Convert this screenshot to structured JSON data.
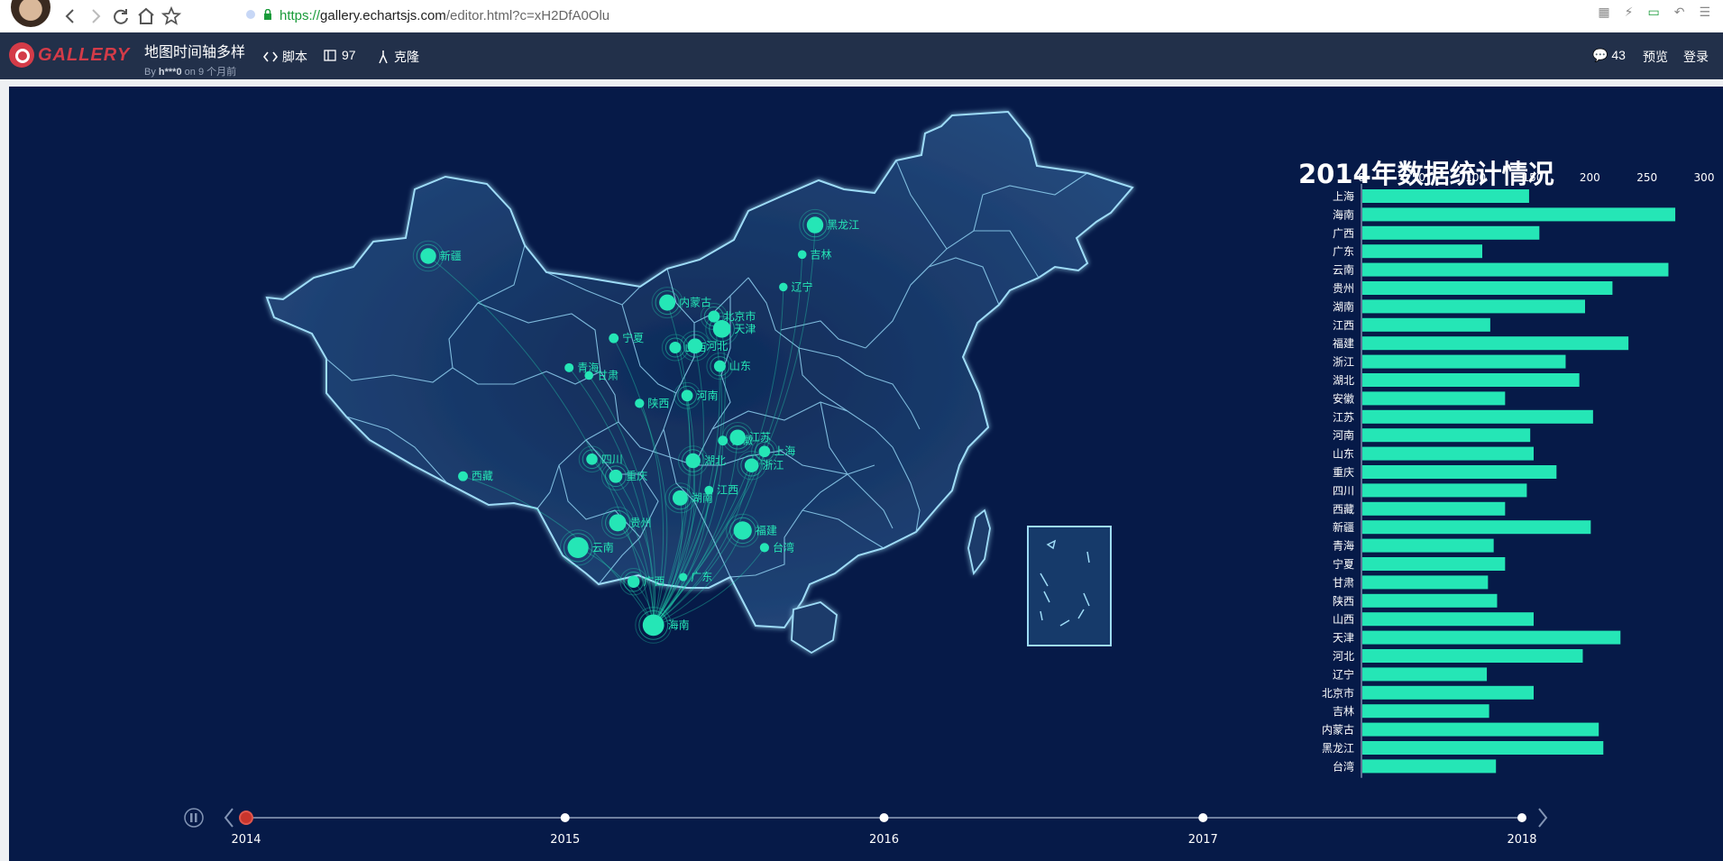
{
  "browser": {
    "url_scheme": "https://",
    "url_host": "gallery.echartsjs.com",
    "url_path": "/editor.html?c=xH2DfA0Olu",
    "back_icon": "chevron-left-icon",
    "forward_icon": "chevron-right-icon",
    "reload_icon": "reload-icon",
    "home_icon": "home-icon",
    "star_icon": "star-icon"
  },
  "appbar": {
    "logo_text": "GALLERY",
    "title": "地图时间轴多样",
    "byline_prefix": "By",
    "author": "h***0",
    "byline_time": "on 9 个月前",
    "script_label": "脚本",
    "likes_count": "97",
    "clone_label": "克隆",
    "comments_count": "43",
    "preview_label": "预览",
    "login_label": "登录"
  },
  "colors": {
    "background": "#061a48",
    "map_fill": "#1f3a6a",
    "map_border": "#8fd4f5",
    "accent": "#25e6b6",
    "timeline_active": "#c8352d"
  },
  "map": {
    "cities": [
      {
        "name": "新疆",
        "value": 200,
        "lon": 87.6,
        "lat": 43.8
      },
      {
        "name": "西藏",
        "value": 125,
        "lon": 91.1,
        "lat": 29.6
      },
      {
        "name": "青海",
        "value": 115,
        "lon": 101.8,
        "lat": 36.6
      },
      {
        "name": "甘肃",
        "value": 110,
        "lon": 103.8,
        "lat": 36.1
      },
      {
        "name": "宁夏",
        "value": 125,
        "lon": 106.3,
        "lat": 38.5
      },
      {
        "name": "内蒙古",
        "value": 207,
        "lon": 111.7,
        "lat": 40.8
      },
      {
        "name": "陕西",
        "value": 118,
        "lon": 108.9,
        "lat": 34.3
      },
      {
        "name": "山西",
        "value": 150,
        "lon": 112.5,
        "lat": 37.9
      },
      {
        "name": "河北",
        "value": 193,
        "lon": 114.5,
        "lat": 38.0
      },
      {
        "name": "北京市",
        "value": 150,
        "lon": 116.4,
        "lat": 39.9
      },
      {
        "name": "天津",
        "value": 226,
        "lon": 117.2,
        "lat": 39.1
      },
      {
        "name": "山东",
        "value": 150,
        "lon": 117.0,
        "lat": 36.7
      },
      {
        "name": "河南",
        "value": 147,
        "lon": 113.7,
        "lat": 34.8
      },
      {
        "name": "四川",
        "value": 144,
        "lon": 104.1,
        "lat": 30.7
      },
      {
        "name": "重庆",
        "value": 170,
        "lon": 106.5,
        "lat": 29.6
      },
      {
        "name": "湖北",
        "value": 190,
        "lon": 114.3,
        "lat": 30.6
      },
      {
        "name": "安徽",
        "value": 125,
        "lon": 117.3,
        "lat": 31.9
      },
      {
        "name": "江苏",
        "value": 202,
        "lon": 118.8,
        "lat": 32.1
      },
      {
        "name": "上海",
        "value": 146,
        "lon": 121.5,
        "lat": 31.2
      },
      {
        "name": "浙江",
        "value": 178,
        "lon": 120.2,
        "lat": 30.3
      },
      {
        "name": "江西",
        "value": 112,
        "lon": 115.9,
        "lat": 28.7
      },
      {
        "name": "湖南",
        "value": 195,
        "lon": 113.0,
        "lat": 28.2
      },
      {
        "name": "福建",
        "value": 233,
        "lon": 119.3,
        "lat": 26.1
      },
      {
        "name": "贵州",
        "value": 219,
        "lon": 106.7,
        "lat": 26.6
      },
      {
        "name": "云南",
        "value": 268,
        "lon": 102.7,
        "lat": 25.0
      },
      {
        "name": "广西",
        "value": 155,
        "lon": 108.3,
        "lat": 22.8
      },
      {
        "name": "广东",
        "value": 105,
        "lon": 113.3,
        "lat": 23.1
      },
      {
        "name": "海南",
        "value": 274,
        "lon": 110.3,
        "lat": 20.0
      },
      {
        "name": "台湾",
        "value": 117,
        "lon": 121.5,
        "lat": 25.0
      },
      {
        "name": "辽宁",
        "value": 109,
        "lon": 123.4,
        "lat": 41.8
      },
      {
        "name": "吉林",
        "value": 111,
        "lon": 125.3,
        "lat": 43.9
      },
      {
        "name": "黑龙江",
        "value": 211,
        "lon": 126.6,
        "lat": 45.8
      }
    ],
    "flow_target": "海南"
  },
  "chart_data": {
    "type": "bar",
    "orientation": "horizontal",
    "title": "2014年数据统计情况",
    "xlim": [
      0,
      300
    ],
    "xticks": [
      0,
      50,
      100,
      150,
      200,
      250,
      300
    ],
    "categories": [
      "上海",
      "海南",
      "广西",
      "广东",
      "云南",
      "贵州",
      "湖南",
      "江西",
      "福建",
      "浙江",
      "湖北",
      "安徽",
      "江苏",
      "河南",
      "山东",
      "重庆",
      "四川",
      "西藏",
      "新疆",
      "青海",
      "宁夏",
      "甘肃",
      "陕西",
      "山西",
      "天津",
      "河北",
      "辽宁",
      "北京市",
      "吉林",
      "内蒙古",
      "黑龙江",
      "台湾"
    ],
    "values": [
      146,
      274,
      155,
      105,
      268,
      219,
      195,
      112,
      233,
      178,
      190,
      125,
      202,
      147,
      150,
      170,
      144,
      125,
      200,
      115,
      125,
      110,
      118,
      150,
      226,
      193,
      109,
      150,
      111,
      207,
      211,
      117
    ],
    "bar_color": "#25e6b6",
    "grid": false
  },
  "timeline": {
    "years": [
      "2014",
      "2015",
      "2016",
      "2017",
      "2018"
    ],
    "current_index": 0,
    "play_icon": "pause-icon",
    "prev_icon": "chevron-left-icon",
    "next_icon": "chevron-right-icon"
  }
}
